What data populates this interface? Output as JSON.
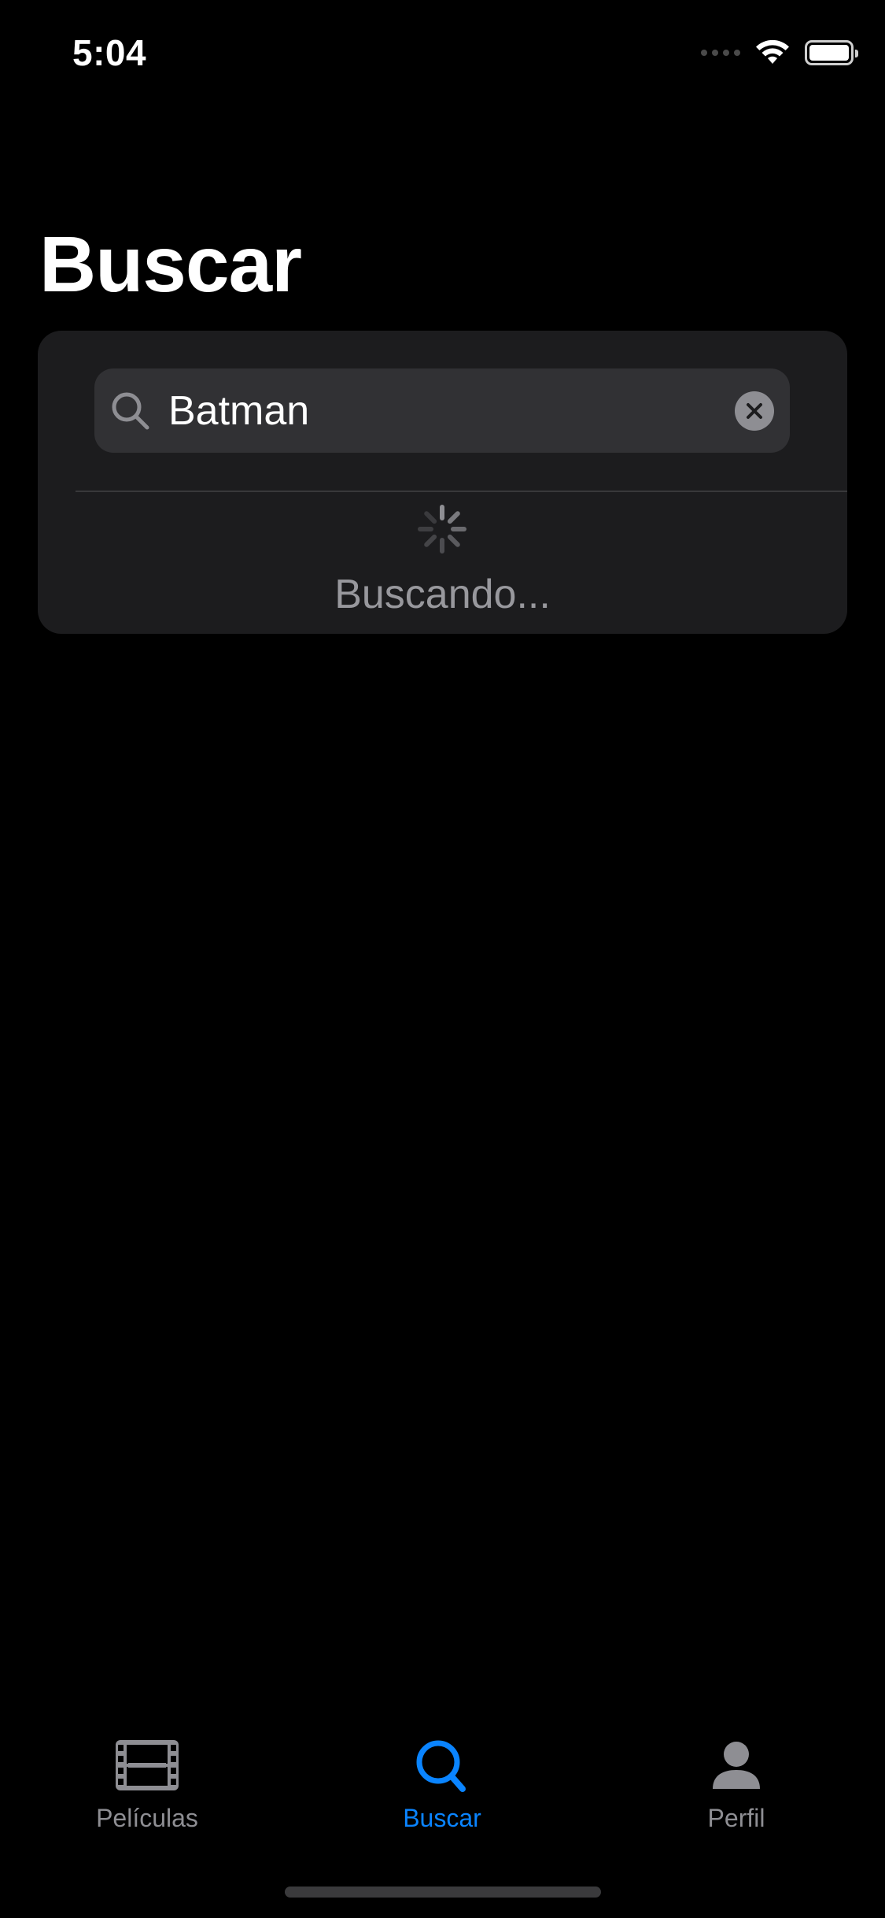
{
  "status_bar": {
    "time": "5:04"
  },
  "header": {
    "title": "Buscar"
  },
  "search": {
    "value": "Batman",
    "placeholder": "Buscar"
  },
  "loading": {
    "text": "Buscando..."
  },
  "tab_bar": {
    "tabs": [
      {
        "label": "Películas",
        "icon": "film-icon",
        "active": false
      },
      {
        "label": "Buscar",
        "icon": "magnifyingglass-icon",
        "active": true
      },
      {
        "label": "Perfil",
        "icon": "person-icon",
        "active": false
      }
    ]
  },
  "colors": {
    "background": "#000000",
    "card": "#1c1c1e",
    "search_field": "#313134",
    "accent": "#0a84ff",
    "inactive": "#8e8e93",
    "secondary_text": "#98989d"
  }
}
